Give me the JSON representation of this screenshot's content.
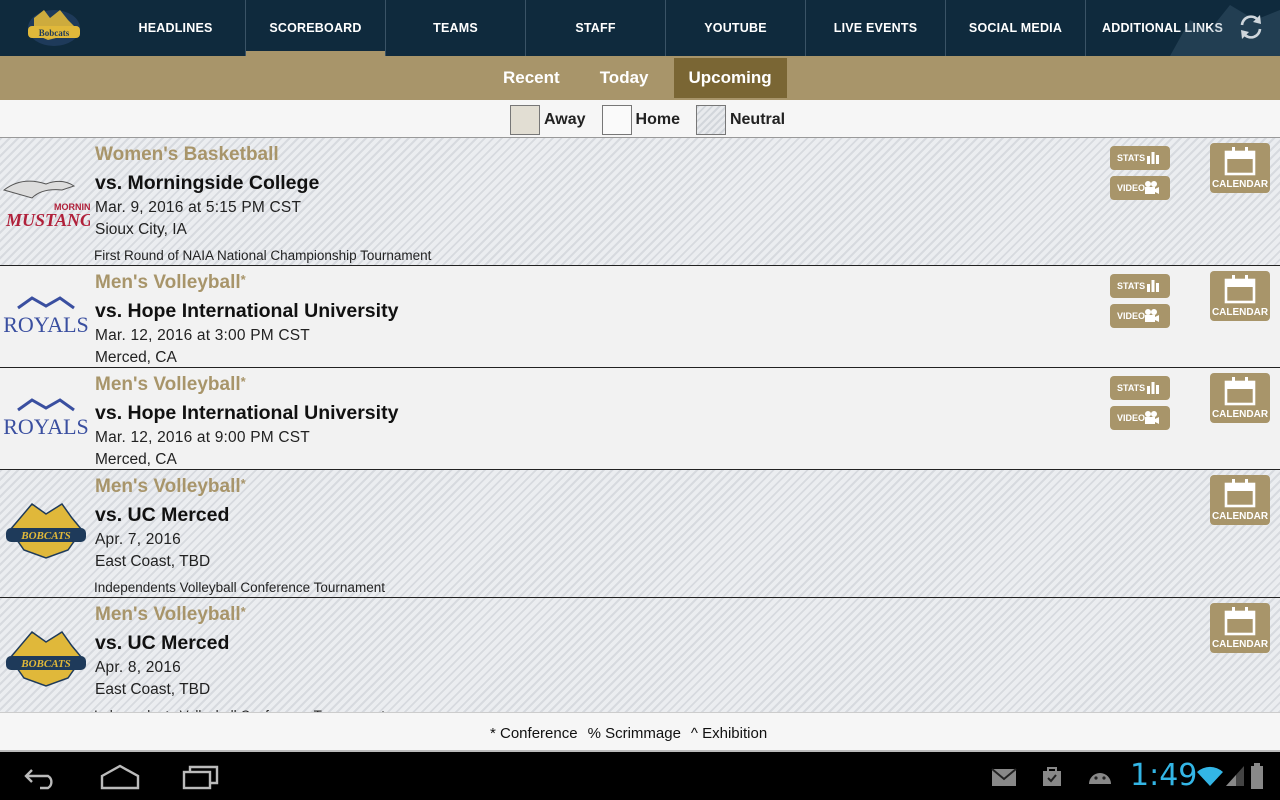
{
  "nav": {
    "items": [
      "HEADLINES",
      "SCOREBOARD",
      "TEAMS",
      "STAFF",
      "YOUTUBE",
      "LIVE EVENTS",
      "SOCIAL MEDIA",
      "ADDITIONAL LINKS"
    ],
    "active_index": 1
  },
  "filters": {
    "tabs": [
      "Recent",
      "Today",
      "Upcoming"
    ],
    "active": "Upcoming"
  },
  "legend": {
    "away": "Away",
    "home": "Home",
    "neutral": "Neutral"
  },
  "buttons": {
    "stats": "STATS",
    "video": "VIDEO",
    "calendar": "CALENDAR"
  },
  "events": [
    {
      "sport": "Women's Basketball",
      "conference": false,
      "opponent": "vs. Morningside College",
      "datetime": "Mar. 9, 2016 at 5:15 PM CST",
      "location": "Sioux City, IA",
      "note": "First Round of NAIA National Championship Tournament",
      "site": "neutral",
      "logo": "morningside-mustangs",
      "logo_text": "MORNINGSIDE MUSTANGS",
      "has_stats_video": true
    },
    {
      "sport": "Men's Volleyball",
      "conference": true,
      "opponent": "vs. Hope International University",
      "datetime": "Mar. 12, 2016 at 3:00 PM CST",
      "location": "Merced, CA",
      "note": "",
      "site": "home",
      "logo": "royals",
      "logo_text": "ROYALS",
      "has_stats_video": true
    },
    {
      "sport": "Men's Volleyball",
      "conference": true,
      "opponent": "vs. Hope International University",
      "datetime": "Mar. 12, 2016 at 9:00 PM CST",
      "location": "Merced, CA",
      "note": "",
      "site": "home",
      "logo": "royals",
      "logo_text": "ROYALS",
      "has_stats_video": true
    },
    {
      "sport": "Men's Volleyball",
      "conference": true,
      "opponent": "vs. UC Merced",
      "datetime": "Apr. 7, 2016",
      "location": "East Coast, TBD",
      "note": "Independents Volleyball Conference Tournament",
      "site": "neutral",
      "logo": "uc-merced-bobcats",
      "logo_text": "BOBCATS",
      "has_stats_video": false
    },
    {
      "sport": "Men's Volleyball",
      "conference": true,
      "opponent": "vs. UC Merced",
      "datetime": "Apr. 8, 2016",
      "location": "East Coast, TBD",
      "note": "Independents Volleyball Conference Tournament",
      "site": "neutral",
      "logo": "uc-merced-bobcats",
      "logo_text": "BOBCATS",
      "has_stats_video": false
    }
  ],
  "footer": {
    "conference": "* Conference",
    "scrimmage": "% Scrimmage",
    "exhibition": "^ Exhibition"
  },
  "system": {
    "clock": "1:49"
  },
  "colors": {
    "navy": "#0f2a3d",
    "gold": "#a8956a",
    "gold_dark": "#7a6634",
    "clock_blue": "#33b5e5"
  }
}
